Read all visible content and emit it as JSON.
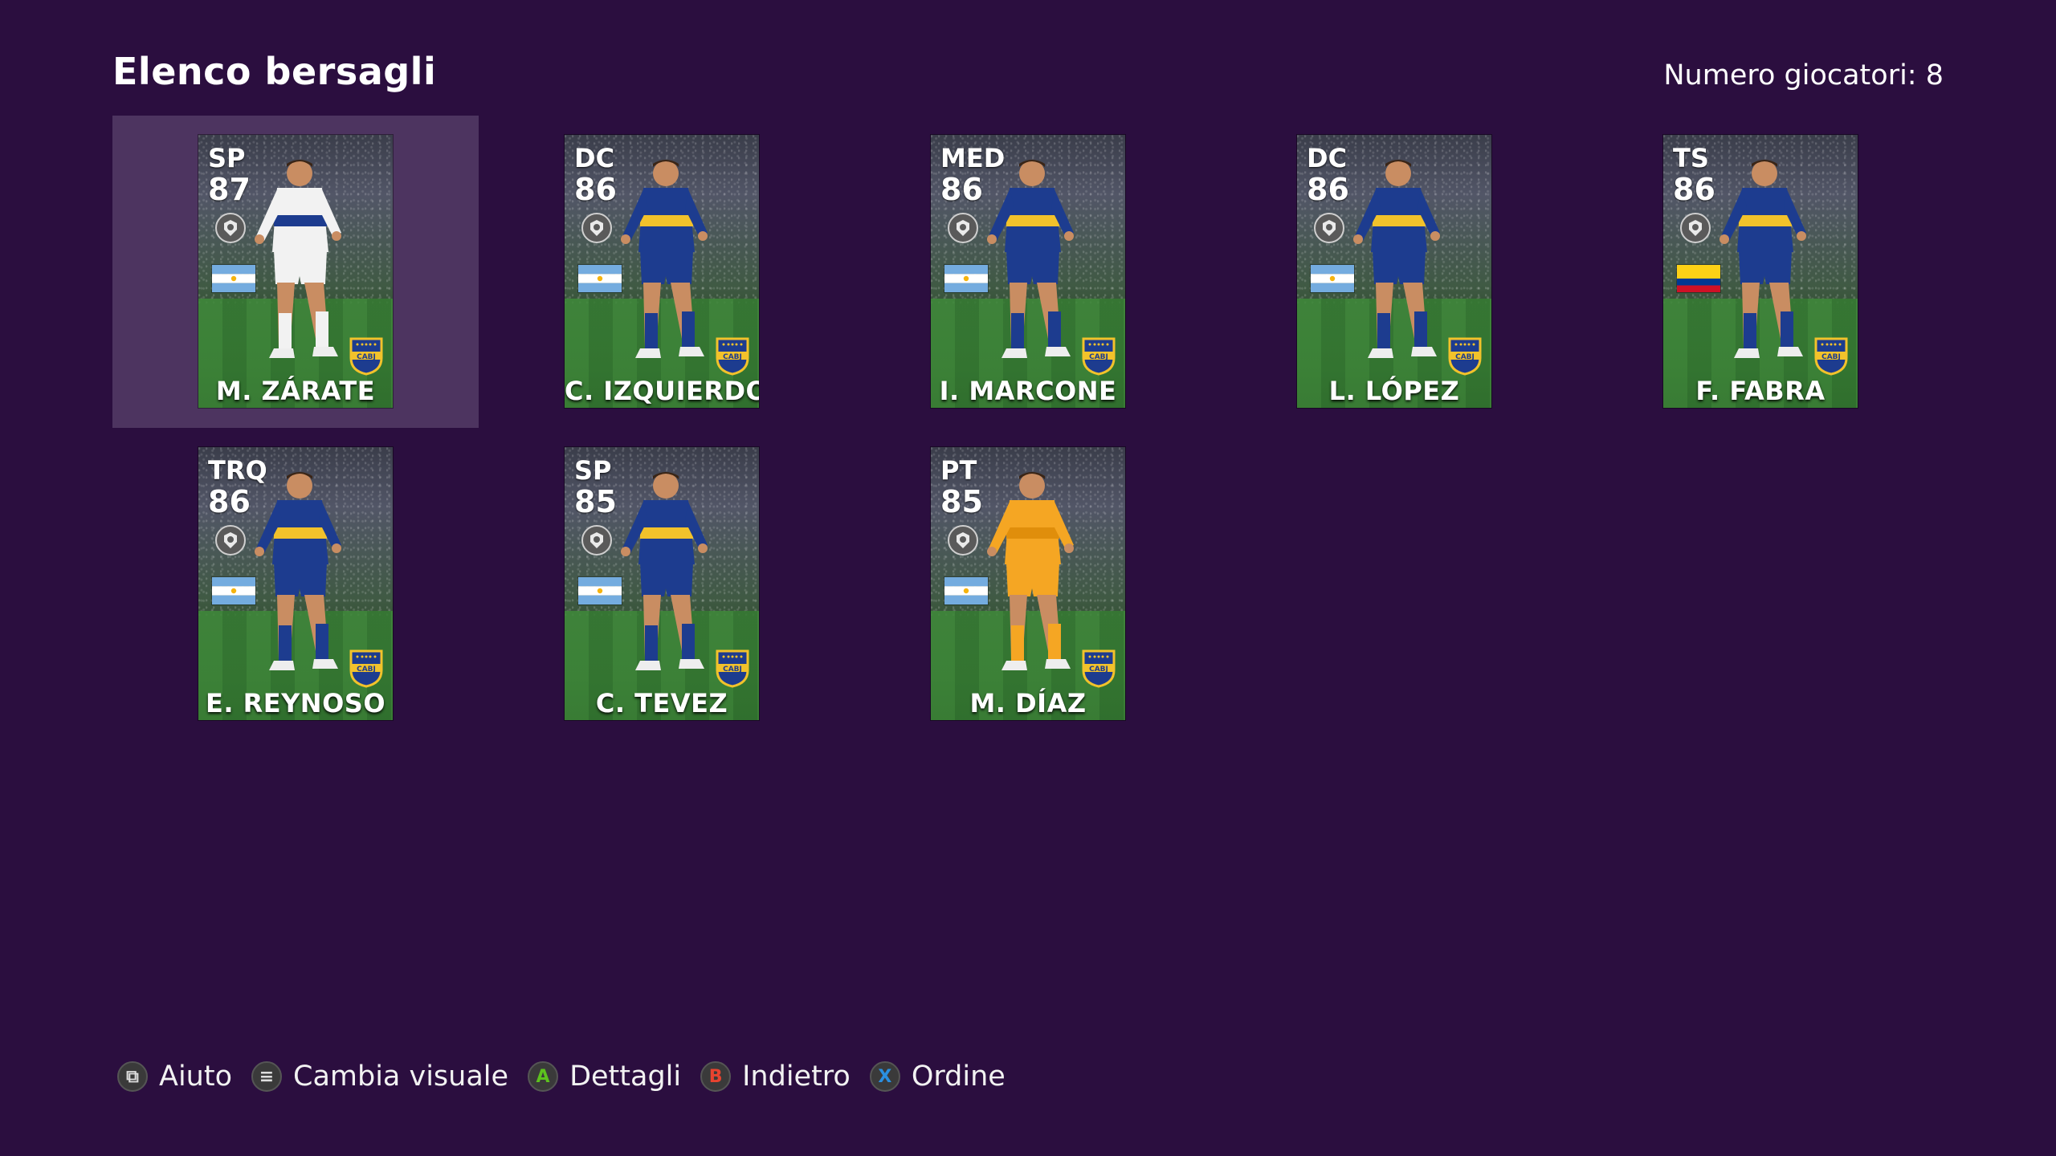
{
  "header": {
    "title": "Elenco bersagli",
    "player_count": "Numero giocatori: 8"
  },
  "players": [
    {
      "position": "SP",
      "rating": "87",
      "name": "M. ZÁRATE",
      "flag": "argentina",
      "kit": "white-away",
      "selected": true
    },
    {
      "position": "DC",
      "rating": "86",
      "name": "C. IZQUIERDOZ",
      "flag": "argentina",
      "kit": "blue-home",
      "selected": false
    },
    {
      "position": "MED",
      "rating": "86",
      "name": "I. MARCONE",
      "flag": "argentina",
      "kit": "blue-home",
      "selected": false
    },
    {
      "position": "DC",
      "rating": "86",
      "name": "L. LÓPEZ",
      "flag": "argentina",
      "kit": "blue-home",
      "selected": false
    },
    {
      "position": "TS",
      "rating": "86",
      "name": "F. FABRA",
      "flag": "colombia",
      "kit": "blue-home",
      "selected": false
    },
    {
      "position": "TRQ",
      "rating": "86",
      "name": "E. REYNOSO",
      "flag": "argentina",
      "kit": "blue-home",
      "selected": false
    },
    {
      "position": "SP",
      "rating": "85",
      "name": "C. TEVEZ",
      "flag": "argentina",
      "kit": "blue-home",
      "selected": false
    },
    {
      "position": "PT",
      "rating": "85",
      "name": "M. DÍAZ",
      "flag": "argentina",
      "kit": "yellow-gk",
      "selected": false
    }
  ],
  "footer": {
    "hints": [
      {
        "button": "⧉",
        "icon": "view-button-icon",
        "label": "Aiuto",
        "color": "#dddddd"
      },
      {
        "button": "≡",
        "icon": "menu-button-icon",
        "label": "Cambia visuale",
        "color": "#dddddd"
      },
      {
        "button": "A",
        "icon": "a-button-icon",
        "label": "Dettagli",
        "color": "#5dc21e"
      },
      {
        "button": "B",
        "icon": "b-button-icon",
        "label": "Indietro",
        "color": "#e8432f"
      },
      {
        "button": "X",
        "icon": "x-button-icon",
        "label": "Ordine",
        "color": "#2a8fe0"
      }
    ]
  },
  "colors": {
    "background": "#2b0e3f",
    "selected_cell": "#4d3460",
    "boca_blue": "#1d3c8f",
    "boca_gold": "#f2c22b"
  }
}
